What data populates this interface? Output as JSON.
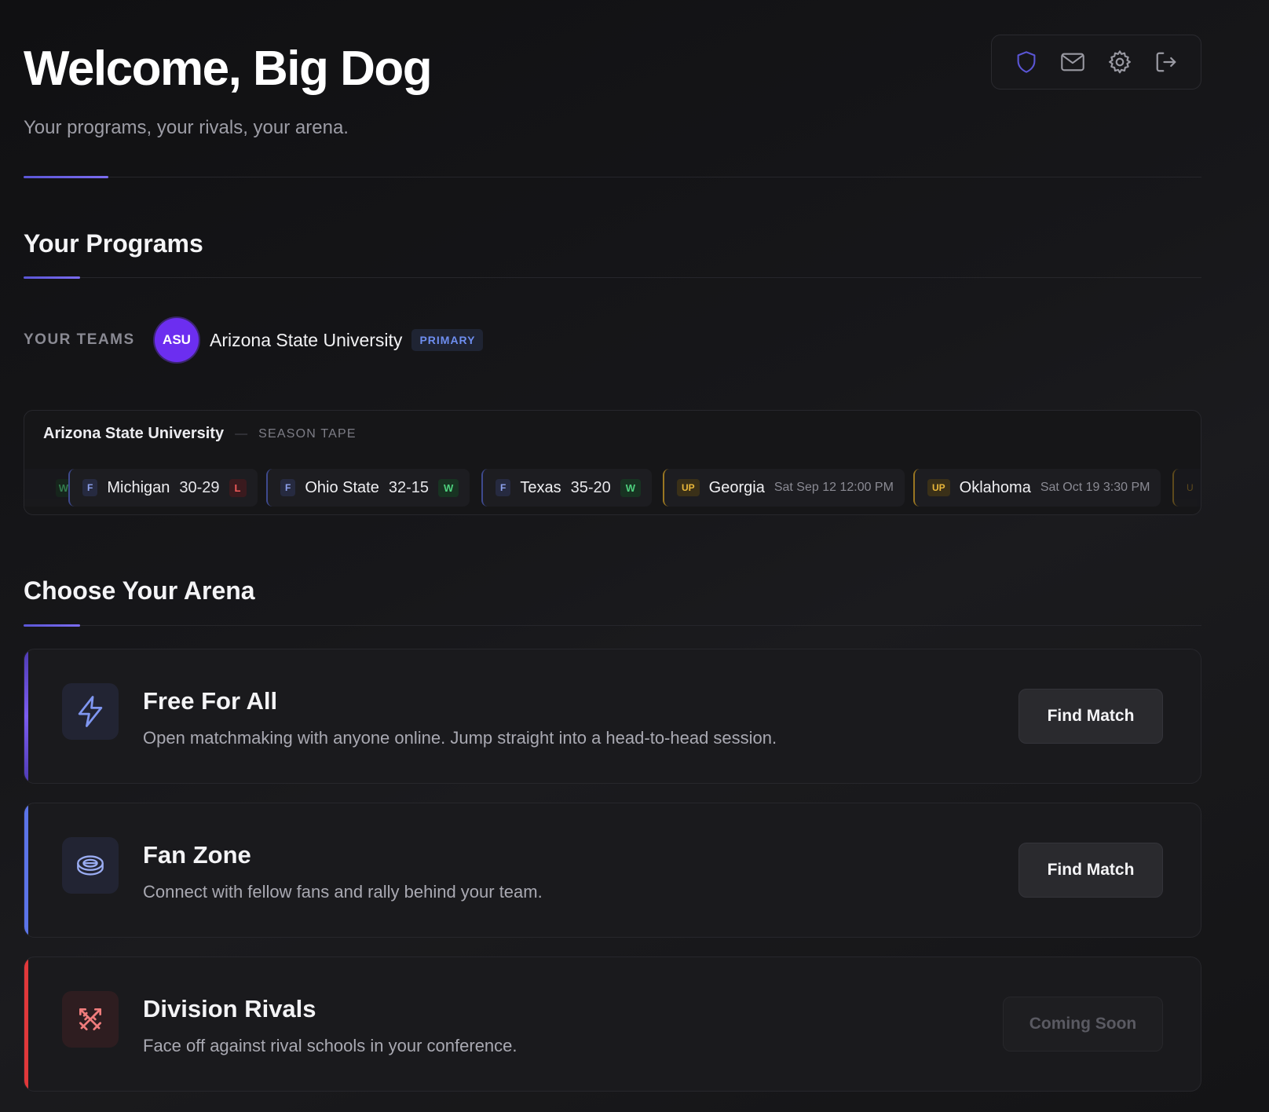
{
  "header": {
    "welcome": "Welcome, Big Dog",
    "subtitle": "Your programs, your rivals, your arena.",
    "icons": [
      "shield-icon",
      "mail-icon",
      "gear-icon",
      "logout-icon"
    ]
  },
  "programs": {
    "title": "Your Programs",
    "teams_label": "YOUR TEAMS",
    "team": {
      "abbr": "ASU",
      "name": "Arizona State University",
      "badge": "PRIMARY"
    }
  },
  "tape": {
    "team": "Arizona State University",
    "dash": "—",
    "label": "SEASON TAPE",
    "partial_left": "W",
    "games": [
      {
        "tag": "F",
        "opponent": "Michigan",
        "score": "30-29",
        "result": "L"
      },
      {
        "tag": "F",
        "opponent": "Ohio State",
        "score": "32-15",
        "result": "W"
      },
      {
        "tag": "F",
        "opponent": "Texas",
        "score": "35-20",
        "result": "W"
      },
      {
        "tag": "UP",
        "opponent": "Georgia",
        "when": "Sat Sep 12 12:00 PM"
      },
      {
        "tag": "UP",
        "opponent": "Oklahoma",
        "when": "Sat Oct 19 3:30 PM"
      }
    ],
    "partial_right": "U"
  },
  "arena": {
    "title": "Choose Your Arena",
    "cards": [
      {
        "title": "Free For All",
        "desc": "Open matchmaking with anyone online. Jump straight into a head-to-head session.",
        "button": "Find Match",
        "accent": "#7b5cf0",
        "icon": "lightning-icon"
      },
      {
        "title": "Fan Zone",
        "desc": "Connect with fellow fans and rally behind your team.",
        "button": "Find Match",
        "accent": "#5b74e8",
        "icon": "stadium-icon"
      },
      {
        "title": "Division Rivals",
        "desc": "Face off against rival schools in your conference.",
        "button": "Coming Soon",
        "accent": "#e0383a",
        "icon": "crossed-swords-icon"
      }
    ]
  }
}
